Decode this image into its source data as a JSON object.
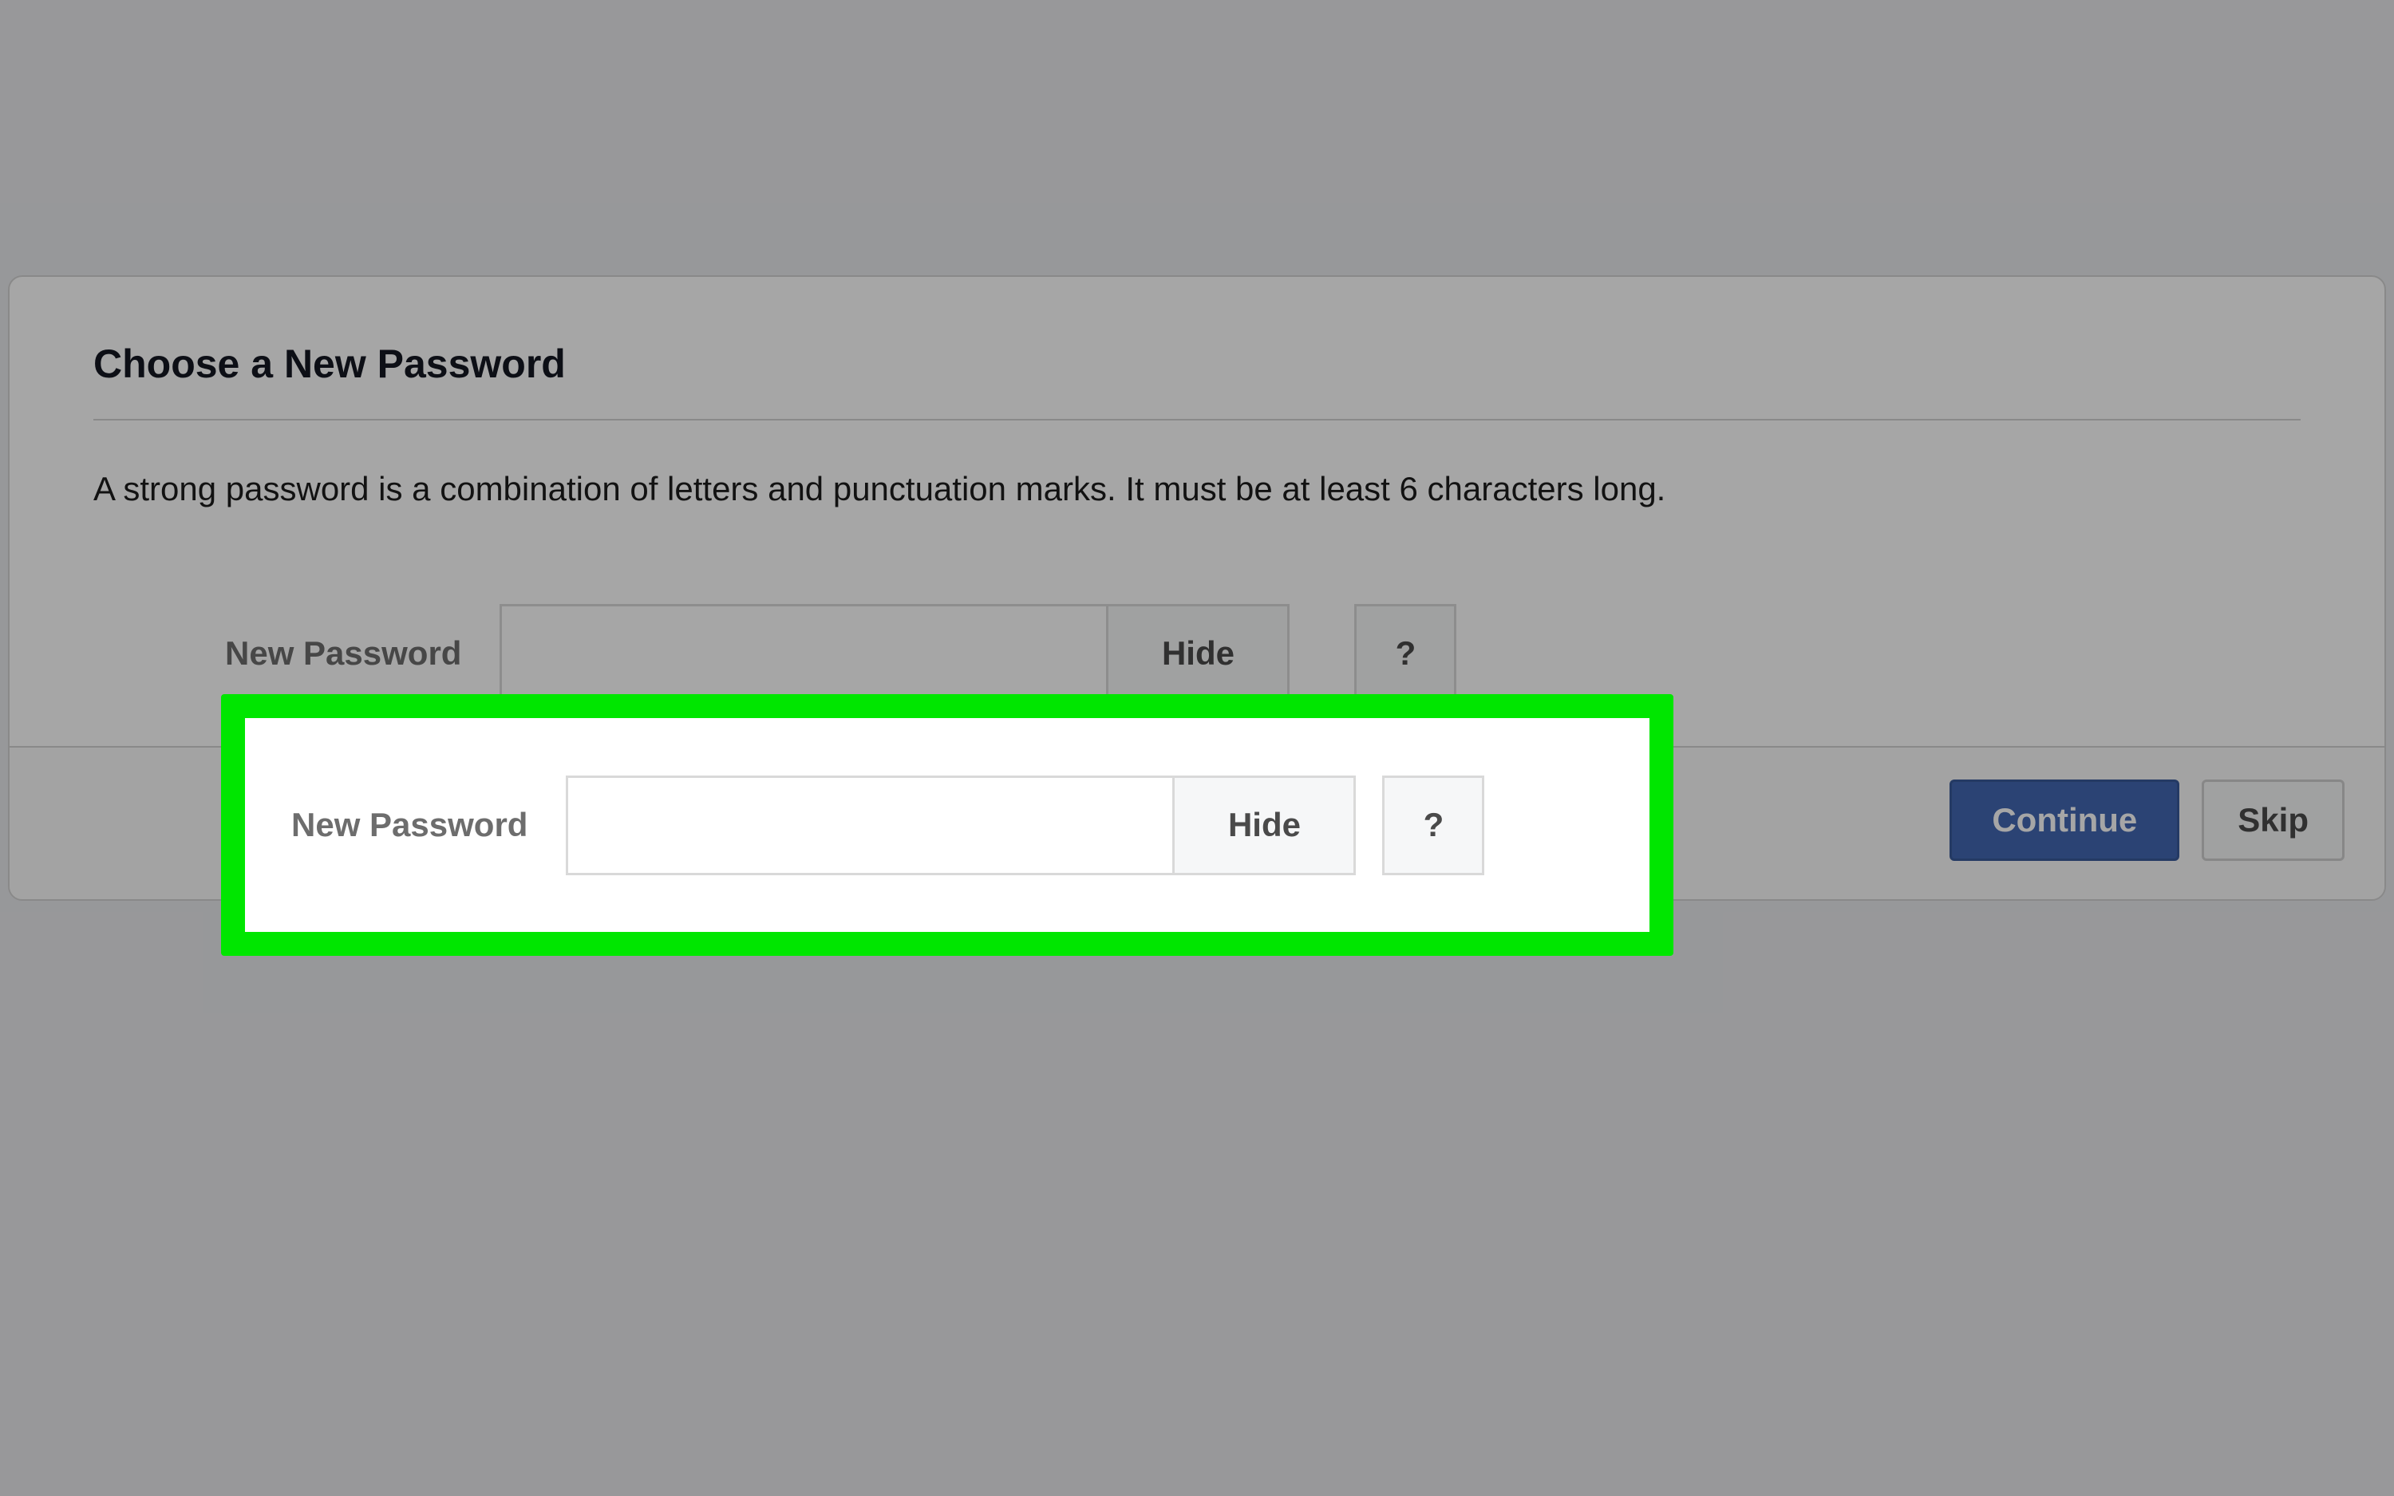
{
  "dialog": {
    "title": "Choose a New Password",
    "description": "A strong password is a combination of letters and punctuation marks. It must be at least 6 characters long.",
    "password_label": "New Password",
    "password_value": "",
    "hide_button_label": "Hide",
    "help_button_label": "?",
    "continue_button_label": "Continue",
    "skip_button_label": "Skip"
  },
  "highlight": {
    "color": "#00e600"
  }
}
